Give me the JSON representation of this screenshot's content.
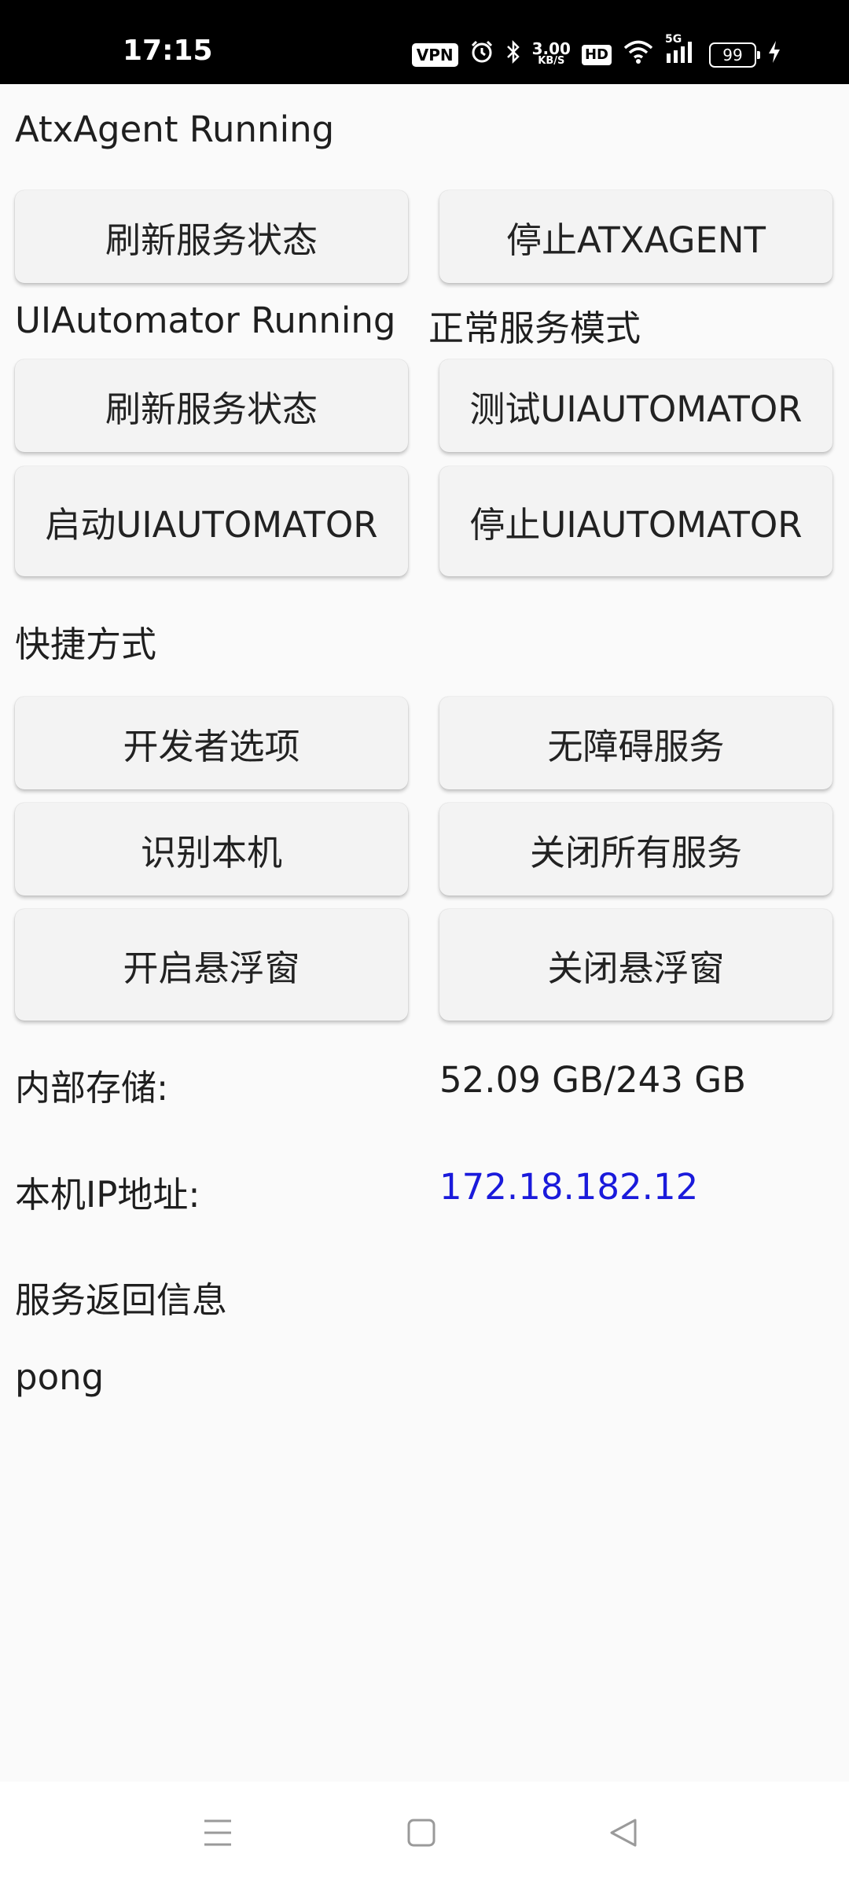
{
  "status_bar": {
    "time": "17:15",
    "vpn": "VPN",
    "speed_value": "3.00",
    "speed_unit": "KB/S",
    "hd": "HD",
    "network": "5G",
    "battery": "99"
  },
  "atx": {
    "status": "AtxAgent Running",
    "refresh_button": "刷新服务状态",
    "stop_button": "停止ATXAGENT"
  },
  "uiautomator": {
    "status": "UIAutomator Running",
    "mode": "正常服务模式",
    "refresh_button": "刷新服务状态",
    "test_button": "测试UIAUTOMATOR",
    "start_button": "启动UIAUTOMATOR",
    "stop_button": "停止UIAUTOMATOR"
  },
  "shortcuts": {
    "title": "快捷方式",
    "developer_options": "开发者选项",
    "accessibility": "无障碍服务",
    "identify_device": "识别本机",
    "close_all_services": "关闭所有服务",
    "open_float": "开启悬浮窗",
    "close_float": "关闭悬浮窗"
  },
  "info": {
    "storage_label": "内部存储:",
    "storage_value": "52.09 GB/243 GB",
    "ip_label": "本机IP地址:",
    "ip_value": "172.18.182.12",
    "ip_color": "#1a1adb",
    "response_title": "服务返回信息",
    "response_value": "pong"
  },
  "nav_bar": {
    "icons": [
      "menu-icon",
      "home-icon",
      "back-icon"
    ]
  }
}
